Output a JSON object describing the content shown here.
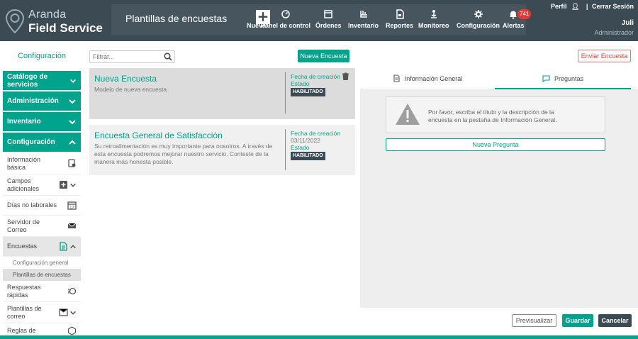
{
  "brand": {
    "line1": "Aranda",
    "line2": "Field Service"
  },
  "header": {
    "title": "Plantillas de encuestas"
  },
  "nav": [
    {
      "label": "Nueva",
      "icon": "plus-icon"
    },
    {
      "label": "Panel de control",
      "icon": "dashboard-icon"
    },
    {
      "label": "Órdenes",
      "icon": "orders-icon"
    },
    {
      "label": "Inventario",
      "icon": "inventory-icon"
    },
    {
      "label": "Reportes",
      "icon": "reports-icon"
    },
    {
      "label": "Monitoreo",
      "icon": "monitor-icon"
    },
    {
      "label": "Configuración",
      "icon": "gear-icon"
    },
    {
      "label": "Alertas",
      "icon": "bell-icon"
    }
  ],
  "alerts_count": "741",
  "user": {
    "profile": "Perfil",
    "logout": "Cerrar Sesión",
    "name": "Juli",
    "role": "Administrador"
  },
  "sidebar": {
    "header": "Configuración",
    "sections": [
      "Catálogo de servicios",
      "Administración",
      "Inventario",
      "Configuración"
    ],
    "items": [
      {
        "label": "Información básica"
      },
      {
        "label": "Campos adicionales"
      },
      {
        "label": "Días no laborales"
      },
      {
        "label": "Servidor de Correo"
      },
      {
        "label": "Encuestas"
      },
      {
        "label": "Respuestas rápidas"
      },
      {
        "label": "Plantillas de correo"
      },
      {
        "label": "Reglas de"
      }
    ],
    "subitems": [
      "Configuración general",
      "Plantillas de encuestas"
    ]
  },
  "toolbar": {
    "filter_placeholder": "Filtrar...",
    "new_survey": "Nueva Encuesta",
    "send_survey": "Enviar Encuesta"
  },
  "cards": [
    {
      "title": "Nueva Encuesta",
      "desc": "Modelo de nueva encuesta",
      "created_label": "Fecha de creación",
      "date": "",
      "state_label": "Estado",
      "status": "HABILITADO"
    },
    {
      "title": "Encuesta General de Satisfacción",
      "desc": "Su retroalimentación es muy importante para nosotros. A través de esta encuesta podremos mejorar nuestro servicio. Conteste de la manera más honesta posible.",
      "created_label": "Fecha de creación",
      "date": "03/11/2022",
      "state_label": "Estado",
      "status": "HABILITADO"
    }
  ],
  "panel": {
    "tab_info": "Información General",
    "tab_questions": "Preguntas",
    "warning": "Por favor, escriba el título y la descripción de la encuesta en la pestaña de Información General.",
    "new_question": "Nueva Pregunta"
  },
  "actions": {
    "preview": "Previsualizar",
    "save": "Guardar",
    "cancel": "Cancelar"
  },
  "colors": {
    "accent": "#00a38b",
    "topbar": "#3c4a54",
    "danger": "#e53935"
  }
}
